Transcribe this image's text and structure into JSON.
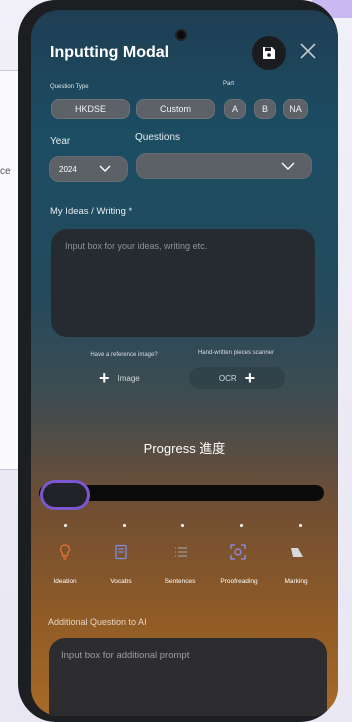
{
  "background": {
    "side_text": "ce"
  },
  "modal": {
    "title": "Inputting Modal"
  },
  "question_type": {
    "label": "Question Type",
    "options": [
      "HKDSE",
      "Custom"
    ]
  },
  "part": {
    "label": "Part",
    "options": [
      "A",
      "B",
      "NA"
    ]
  },
  "year": {
    "label": "Year",
    "value": "2024"
  },
  "questions": {
    "label": "Questions",
    "value": ""
  },
  "ideas": {
    "label": "My Ideas / Writing *",
    "placeholder": "Input box for your ideas, writing etc."
  },
  "reference": {
    "caption": "Have a reference image?",
    "button_label": "Image"
  },
  "scanner": {
    "caption": "Hand-written pieces scanner",
    "button_label": "OCR"
  },
  "progress": {
    "title": "Progress 進度",
    "value": 0,
    "steps": [
      {
        "label": "Ideation",
        "icon": "bulb-icon"
      },
      {
        "label": "Vocabs",
        "icon": "book-icon"
      },
      {
        "label": "Sentences",
        "icon": "list-icon"
      },
      {
        "label": "Proofreading",
        "icon": "scan-check-icon"
      },
      {
        "label": "Marking",
        "icon": "eraser-icon"
      }
    ]
  },
  "additional": {
    "label": "Additional Question to AI",
    "placeholder": "Input box for additional prompt"
  },
  "colors": {
    "accent": "#7b57d0",
    "ideation": "#e0703a",
    "vocabs": "#7b8ee8",
    "proofreading": "#8d8ff0"
  }
}
